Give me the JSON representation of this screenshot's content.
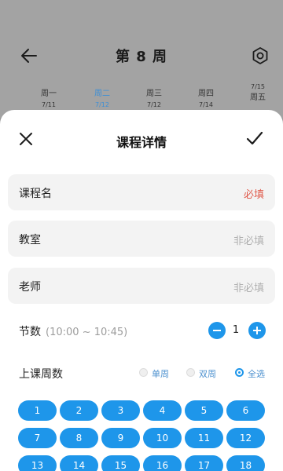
{
  "header": {
    "title": "第 8 周",
    "days": [
      {
        "name": "周一",
        "date": "7/11"
      },
      {
        "name": "周二",
        "date": "7/12"
      },
      {
        "name": "周三",
        "date": "7/12"
      },
      {
        "name": "周四",
        "date": "7/14"
      },
      {
        "name": "周五",
        "date": "7/15"
      }
    ]
  },
  "sheet": {
    "title": "课程详情",
    "fields": [
      {
        "label": "课程名",
        "placeholder": "必填"
      },
      {
        "label": "教室",
        "placeholder": "非必填"
      },
      {
        "label": "老师",
        "placeholder": "非必填"
      }
    ],
    "period": {
      "label": "节数",
      "time": "(10:00 ~ 10:45)",
      "value": "1"
    },
    "weeks": {
      "label": "上课周数",
      "options": [
        "单周",
        "双周",
        "全选"
      ],
      "selected": "全选",
      "numbers": [
        "1",
        "2",
        "3",
        "4",
        "5",
        "6",
        "7",
        "8",
        "9",
        "10",
        "11",
        "12",
        "13",
        "14",
        "15",
        "16",
        "17",
        "18"
      ]
    }
  },
  "colors": {
    "accent": "#1e96ea",
    "required": "#e05a4b"
  }
}
